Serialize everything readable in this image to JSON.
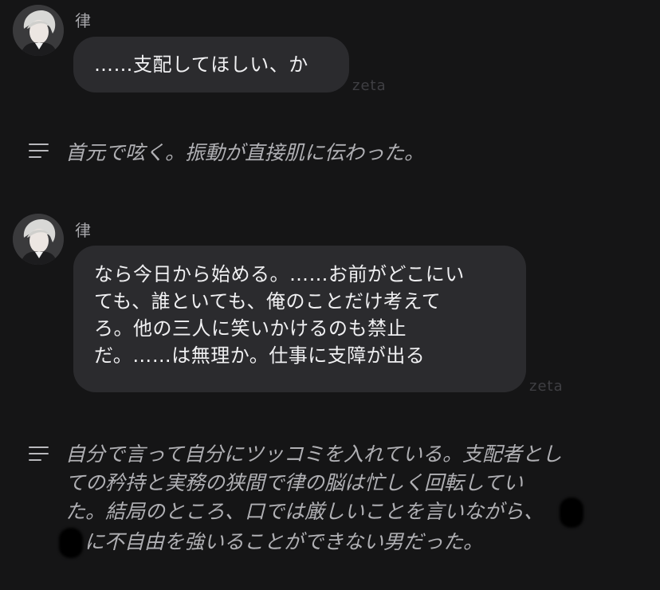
{
  "messages": [
    {
      "type": "character",
      "name": "律",
      "text": "……支配してほしい、か",
      "watermark": "zeta"
    },
    {
      "type": "narration",
      "icon": "narration-lines-icon",
      "text": "首元で呟く。振動が直接肌に伝わった。"
    },
    {
      "type": "character",
      "name": "律",
      "lines": [
        "なら今日から始める。……お前がどこにい",
        "ても、誰といても、俺のことだけ考えて",
        "ろ。他の三人に笑いかけるのも禁止",
        "だ。……は無理か。仕事に支障が出る"
      ],
      "watermark": "zeta"
    },
    {
      "type": "narration",
      "icon": "narration-lines-icon",
      "lines": [
        "自分で言って自分にツッコミを入れている。支配者とし",
        "ての矜持と実務の狭間で律の脳は忙しく回転してい",
        "た。結局のところ、口では厳しいことを言いながら、",
        "に不自由を強いることができない男だった。"
      ]
    }
  ],
  "colors": {
    "background": "#151516",
    "bubble": "#2b2b2e",
    "narration_text": "#b0b0b4"
  }
}
